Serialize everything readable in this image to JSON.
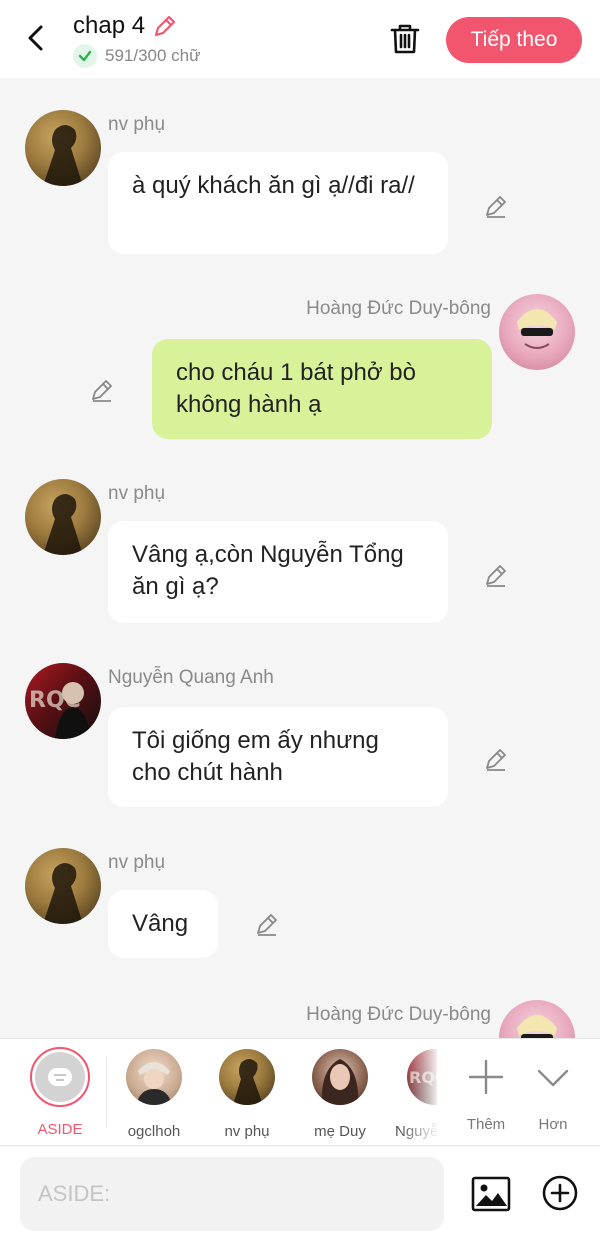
{
  "header": {
    "title": "chap 4",
    "word_count": "591/300 chữ",
    "next_label": "Tiếp theo"
  },
  "messages": [
    {
      "side": "left",
      "sender": "nv phụ",
      "text": "à quý khách ăn gì ạ//đi ra//"
    },
    {
      "side": "right",
      "sender": "Hoàng Đức Duy-bông",
      "text": "cho cháu 1 bát phở bò không hành ạ"
    },
    {
      "side": "left",
      "sender": "nv phụ",
      "text": "Vâng ạ,còn Nguyễn Tổng ăn gì ạ?"
    },
    {
      "side": "left",
      "sender": "Nguyễn Quang Anh",
      "text": "Tôi giống em ấy nhưng cho chút hành"
    },
    {
      "side": "left",
      "sender": "nv phụ",
      "text": "Vâng"
    },
    {
      "side": "right",
      "sender": "Hoàng Đức Duy-bông",
      "text": ""
    }
  ],
  "characters": {
    "aside": "ASIDE",
    "items": [
      "ogclhoh",
      "nv phụ",
      "mẹ Duy",
      "Nguyễn Quang Anh"
    ],
    "add_label": "Thêm",
    "more_label": "Hơn"
  },
  "input": {
    "placeholder": "ASIDE:"
  },
  "colors": {
    "accent": "#f2566e",
    "right_bubble": "#d8f29a",
    "left_bubble": "#ffffff",
    "background": "#f5f5f5"
  }
}
